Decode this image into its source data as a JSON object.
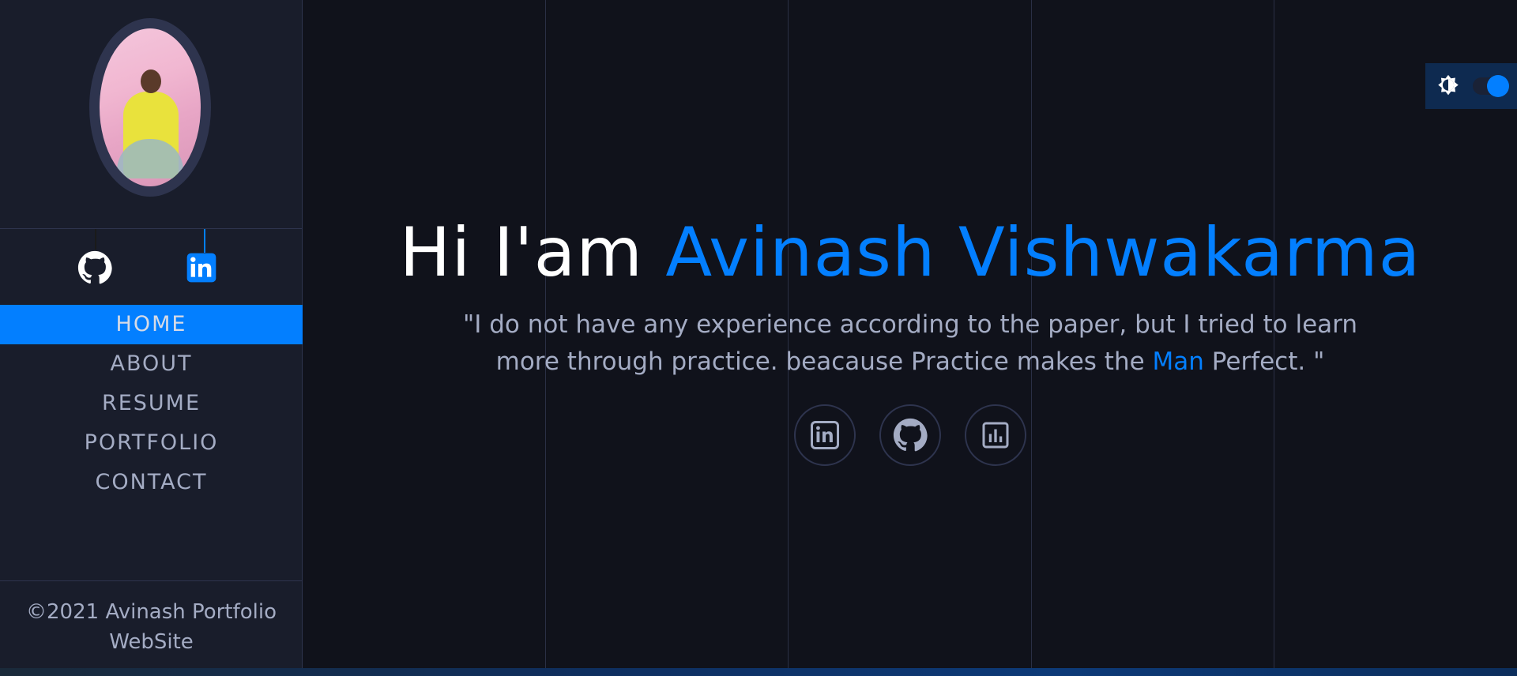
{
  "sidebar": {
    "nav": [
      {
        "label": "HOME",
        "active": true
      },
      {
        "label": "ABOUT",
        "active": false
      },
      {
        "label": "RESUME",
        "active": false
      },
      {
        "label": "PORTFOLIO",
        "active": false
      },
      {
        "label": "CONTACT",
        "active": false
      }
    ],
    "social_icons": [
      "github-icon",
      "linkedin-icon"
    ],
    "footer_line1": "©2021 Avinash Portfolio",
    "footer_line2": "WebSite"
  },
  "hero": {
    "greeting": "Hi I'am ",
    "name": "Avinash Vishwakarma",
    "quote_part1": "\"I do not have any experience according to the paper, but I tried to learn more through practice. beacause Practice makes the ",
    "quote_accent": "Man",
    "quote_part2": " Perfect. \"",
    "icons": [
      "linkedin-icon",
      "github-icon",
      "chart-icon"
    ]
  },
  "theme_toggle": {
    "icon": "brightness-icon",
    "on": true
  },
  "colors": {
    "accent": "#037fff",
    "sidebar_bg": "#191d2b",
    "main_bg": "#10121b",
    "text": "#a4acc4"
  }
}
